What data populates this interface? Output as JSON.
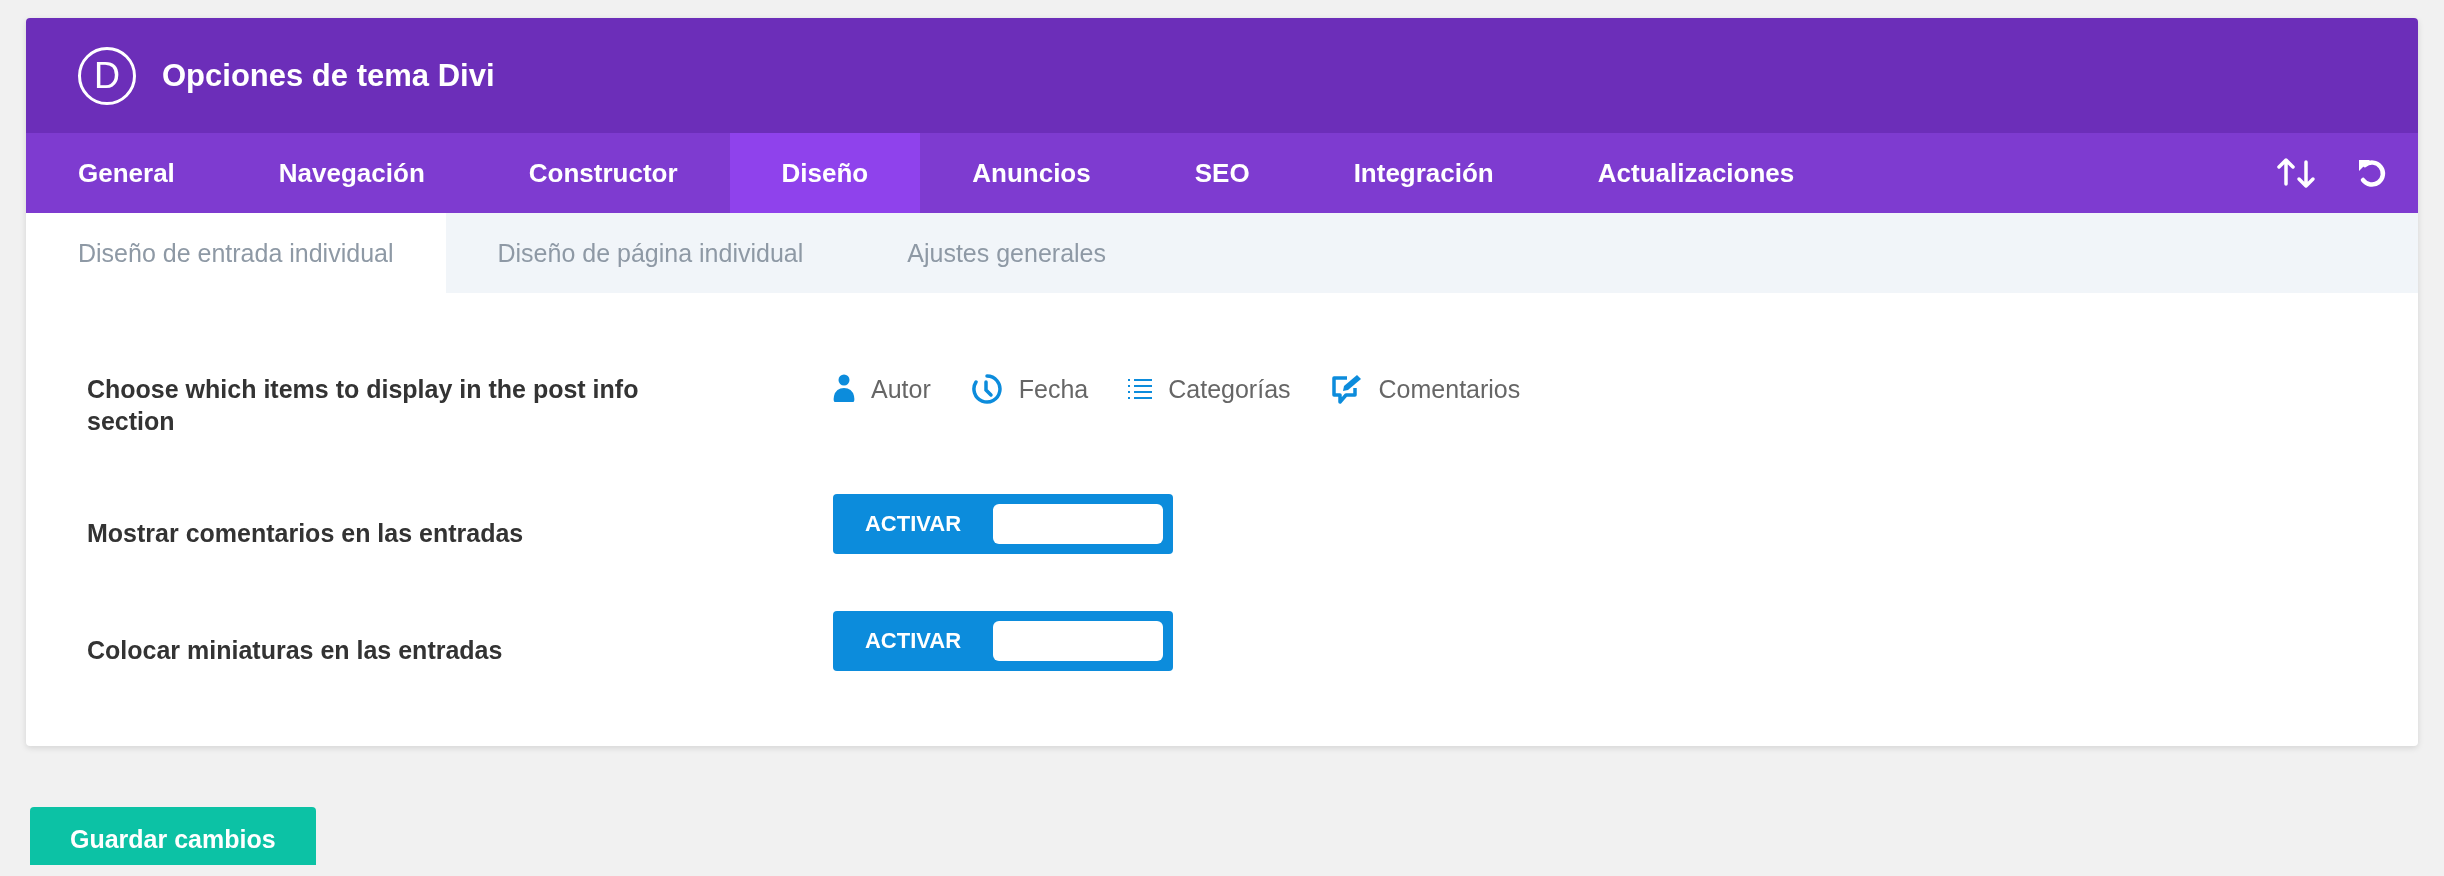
{
  "header": {
    "logo": "D",
    "title": "Opciones de tema Divi"
  },
  "tabs": [
    {
      "label": "General",
      "selected": false
    },
    {
      "label": "Navegación",
      "selected": false
    },
    {
      "label": "Constructor",
      "selected": false
    },
    {
      "label": "Diseño",
      "selected": true
    },
    {
      "label": "Anuncios",
      "selected": false
    },
    {
      "label": "SEO",
      "selected": false
    },
    {
      "label": "Integración",
      "selected": false
    },
    {
      "label": "Actualizaciones",
      "selected": false
    }
  ],
  "subtabs": [
    {
      "label": "Diseño de entrada individual",
      "selected": true
    },
    {
      "label": "Diseño de página individual",
      "selected": false
    },
    {
      "label": "Ajustes generales",
      "selected": false
    }
  ],
  "settings": [
    {
      "kind": "checklist",
      "label": "Choose which items to display in the post info section",
      "items": [
        {
          "kind": "author",
          "label": "Autor",
          "checked": true
        },
        {
          "kind": "date",
          "label": "Fecha",
          "checked": true
        },
        {
          "kind": "categories",
          "label": "Categorías",
          "checked": true
        },
        {
          "kind": "comments",
          "label": "Comentarios",
          "checked": true
        }
      ]
    },
    {
      "kind": "toggle",
      "label": "Mostrar comentarios en las entradas",
      "toggle_label": "ACTIVAR",
      "on": true
    },
    {
      "kind": "toggle",
      "label": "Colocar miniaturas en las entradas",
      "toggle_label": "ACTIVAR",
      "on": true
    }
  ],
  "save_button": "Guardar cambios"
}
